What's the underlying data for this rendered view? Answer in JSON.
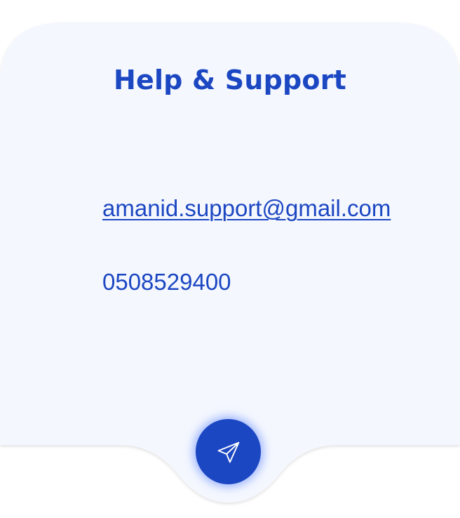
{
  "support": {
    "title": "Help & Support",
    "email": "amanid.support@gmail.com",
    "phone": "0508529400"
  },
  "actions": {
    "send_icon": "send-icon"
  },
  "colors": {
    "accent": "#1c47c2",
    "card_background": "#f4f7fe",
    "page_background": "#ffffff"
  }
}
